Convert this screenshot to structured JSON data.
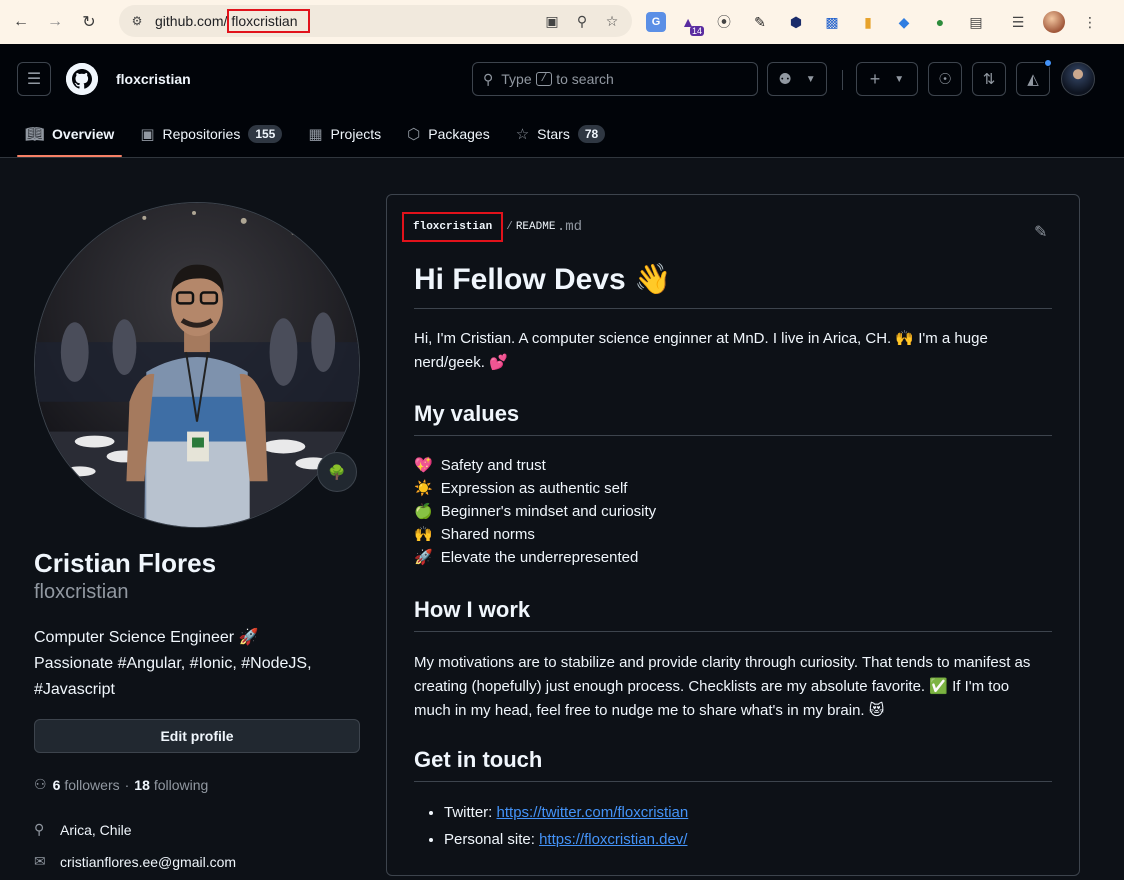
{
  "browser": {
    "url_host": "github.com/",
    "url_path": "floxcristian",
    "extension_badge": "14"
  },
  "header": {
    "username": "floxcristian",
    "search_text": "Type",
    "search_key": "/",
    "search_suffix": "to search"
  },
  "tabs": [
    {
      "label": "Overview",
      "icon": "book-icon"
    },
    {
      "label": "Repositories",
      "icon": "repo-icon",
      "count": "155"
    },
    {
      "label": "Projects",
      "icon": "table-icon"
    },
    {
      "label": "Packages",
      "icon": "package-icon"
    },
    {
      "label": "Stars",
      "icon": "star-icon",
      "count": "78"
    }
  ],
  "profile": {
    "status_emoji": "🌳",
    "full_name": "Cristian Flores",
    "login": "floxcristian",
    "bio_line1": "Computer Science Engineer 🚀",
    "bio_line2": "Passionate #Angular, #Ionic, #NodeJS,",
    "bio_line3": "#Javascript",
    "edit_label": "Edit profile",
    "followers_count": "6",
    "followers_label": "followers",
    "separator": "·",
    "following_count": "18",
    "following_label": "following",
    "location": "Arica, Chile",
    "email": "cristianflores.ee@gmail.com"
  },
  "readme": {
    "owner": "floxcristian",
    "slash": "/",
    "file": "README",
    "ext": ".md",
    "title": "Hi Fellow Devs 👋",
    "intro_line1": "Hi, I'm Cristian. A computer science enginner at MnD. I live in Arica, CH. 🙌 I'm a huge",
    "intro_line2": "nerd/geek. 💕",
    "values_heading": "My values",
    "values": [
      {
        "emoji": "💖",
        "text": "Safety and trust"
      },
      {
        "emoji": "☀️",
        "text": "Expression as authentic self"
      },
      {
        "emoji": "🍏",
        "text": "Beginner's mindset and curiosity"
      },
      {
        "emoji": "🙌",
        "text": "Shared norms"
      },
      {
        "emoji": "🚀",
        "text": "Elevate the underrepresented"
      }
    ],
    "work_heading": "How I work",
    "work_line1": "My motivations are to stabilize and provide clarity through curiosity. That tends to manifest as",
    "work_line2": "creating (hopefully) just enough process. Checklists are my absolute favorite. ✅ If I'm too",
    "work_line3": "much in my head, feel free to nudge me to share what's in my brain. 😻",
    "touch_heading": "Get in touch",
    "twitter_label": "Twitter:",
    "twitter_url": "https://twitter.com/floxcristian",
    "site_label": "Personal site:",
    "site_url": "https://floxcristian.dev/"
  },
  "colors": {
    "accent": "#f78166",
    "link": "#4493f8",
    "highlight": "#e1121b",
    "background": "#0d1117"
  }
}
